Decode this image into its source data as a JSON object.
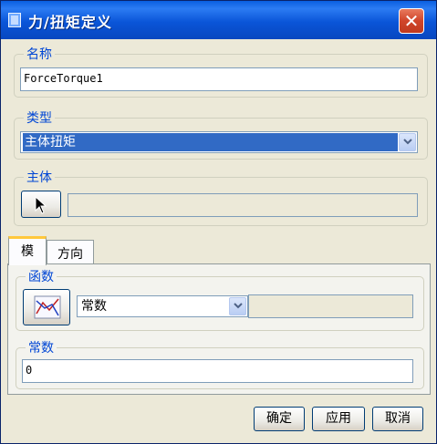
{
  "window": {
    "title": "力/扭矩定义",
    "close_glyph": "✕"
  },
  "name_group": {
    "legend": "名称",
    "value": "ForceTorque1"
  },
  "type_group": {
    "legend": "类型",
    "selected": "主体扭矩"
  },
  "body_group": {
    "legend": "主体",
    "select_icon": "cursor-arrow-icon",
    "value": ""
  },
  "tabs": [
    {
      "label": "模"
    },
    {
      "label": "方向"
    }
  ],
  "function_group": {
    "legend": "函数",
    "icon": "function-graph-icon",
    "selected": "常数",
    "extra_value": ""
  },
  "constant_group": {
    "legend": "常数",
    "value": "0"
  },
  "buttons": {
    "ok": "确定",
    "apply": "应用",
    "cancel": "取消"
  },
  "colors": {
    "title_bar": "#0a55d8",
    "selection": "#316ac5",
    "legend_text": "#0046d5",
    "close_button": "#d0452a"
  }
}
